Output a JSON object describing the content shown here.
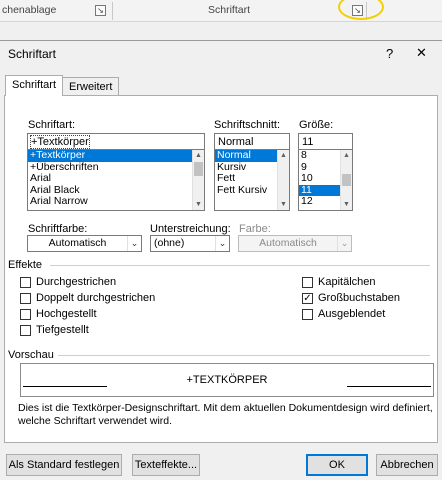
{
  "ribbon": {
    "group_left": "chenablage",
    "group_right": "Schriftart",
    "launcher_glyph": "↘"
  },
  "dialog": {
    "title": "Schriftart",
    "help": "?",
    "close": "✕",
    "tabs": [
      {
        "label": "Schriftart"
      },
      {
        "label": "Erweitert"
      }
    ],
    "font": {
      "label": "Schriftart:",
      "value": "+Textkörper",
      "items": [
        "+Textkörper",
        "+Überschriften",
        "Arial",
        "Arial Black",
        "Arial Narrow"
      ],
      "selected": 0
    },
    "style": {
      "label": "Schriftschnitt:",
      "value": "Normal",
      "items": [
        "Normal",
        "Kursiv",
        "Fett",
        "Fett Kursiv"
      ],
      "selected": 0
    },
    "size": {
      "label": "Größe:",
      "value": "11",
      "items": [
        "8",
        "9",
        "10",
        "11",
        "12"
      ],
      "selected": 3
    },
    "fontcolor": {
      "label": "Schriftfarbe:",
      "value": "Automatisch"
    },
    "underline": {
      "label": "Unterstreichung:",
      "value": "(ohne)"
    },
    "color": {
      "label": "Farbe:",
      "value": "Automatisch"
    },
    "effects": {
      "label": "Effekte",
      "left": [
        {
          "label": "Durchgestrichen",
          "checked": false
        },
        {
          "label": "Doppelt durchgestrichen",
          "checked": false
        },
        {
          "label": "Hochgestellt",
          "checked": false
        },
        {
          "label": "Tiefgestellt",
          "checked": false
        }
      ],
      "right": [
        {
          "label": "Kapitälchen",
          "checked": false
        },
        {
          "label": "Großbuchstaben",
          "checked": true
        },
        {
          "label": "Ausgeblendet",
          "checked": false
        }
      ]
    },
    "preview": {
      "label": "Vorschau",
      "text": "+TEXTKÖRPER",
      "description": "Dies ist die Textkörper-Designschriftart. Mit dem aktuellen Dokumentdesign wird definiert, welche Schriftart verwendet wird."
    },
    "buttons": {
      "default": "Als Standard festlegen",
      "effects": "Texteffekte...",
      "ok": "OK",
      "cancel": "Abbrechen"
    }
  },
  "colors": {
    "accent": "#0078d7",
    "highlight_ring": "#f0d000"
  }
}
